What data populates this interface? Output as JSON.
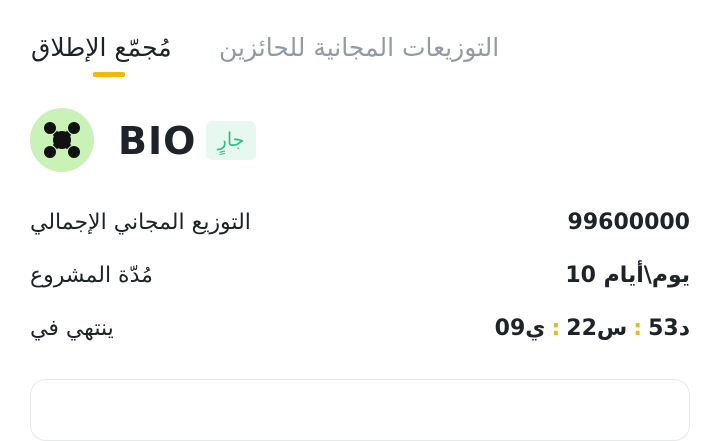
{
  "tabs": {
    "launchpool_label": "مُجمّع الإطلاق",
    "airdrop_label": "التوزيعات المجانية للحائزين"
  },
  "token": {
    "name": "BIO",
    "status": "جارٍ",
    "logo_icon": "bio-molecule-icon",
    "logo_bg": "#c8f2b6"
  },
  "details": {
    "total_airdrop_label": "التوزيع المجاني الإجمالي",
    "total_airdrop_value": "99600000",
    "duration_label": "مُدّة المشروع",
    "duration_value": "10 يوم\\أيام",
    "ends_in_label": "ينتهي في",
    "countdown": {
      "days": "09ي",
      "hours": "22س",
      "minutes": "53د"
    }
  },
  "colors": {
    "accent": "#f0b90b",
    "status_green": "#2ebd85",
    "text_primary": "#1e2329",
    "text_secondary": "#929aa5"
  }
}
